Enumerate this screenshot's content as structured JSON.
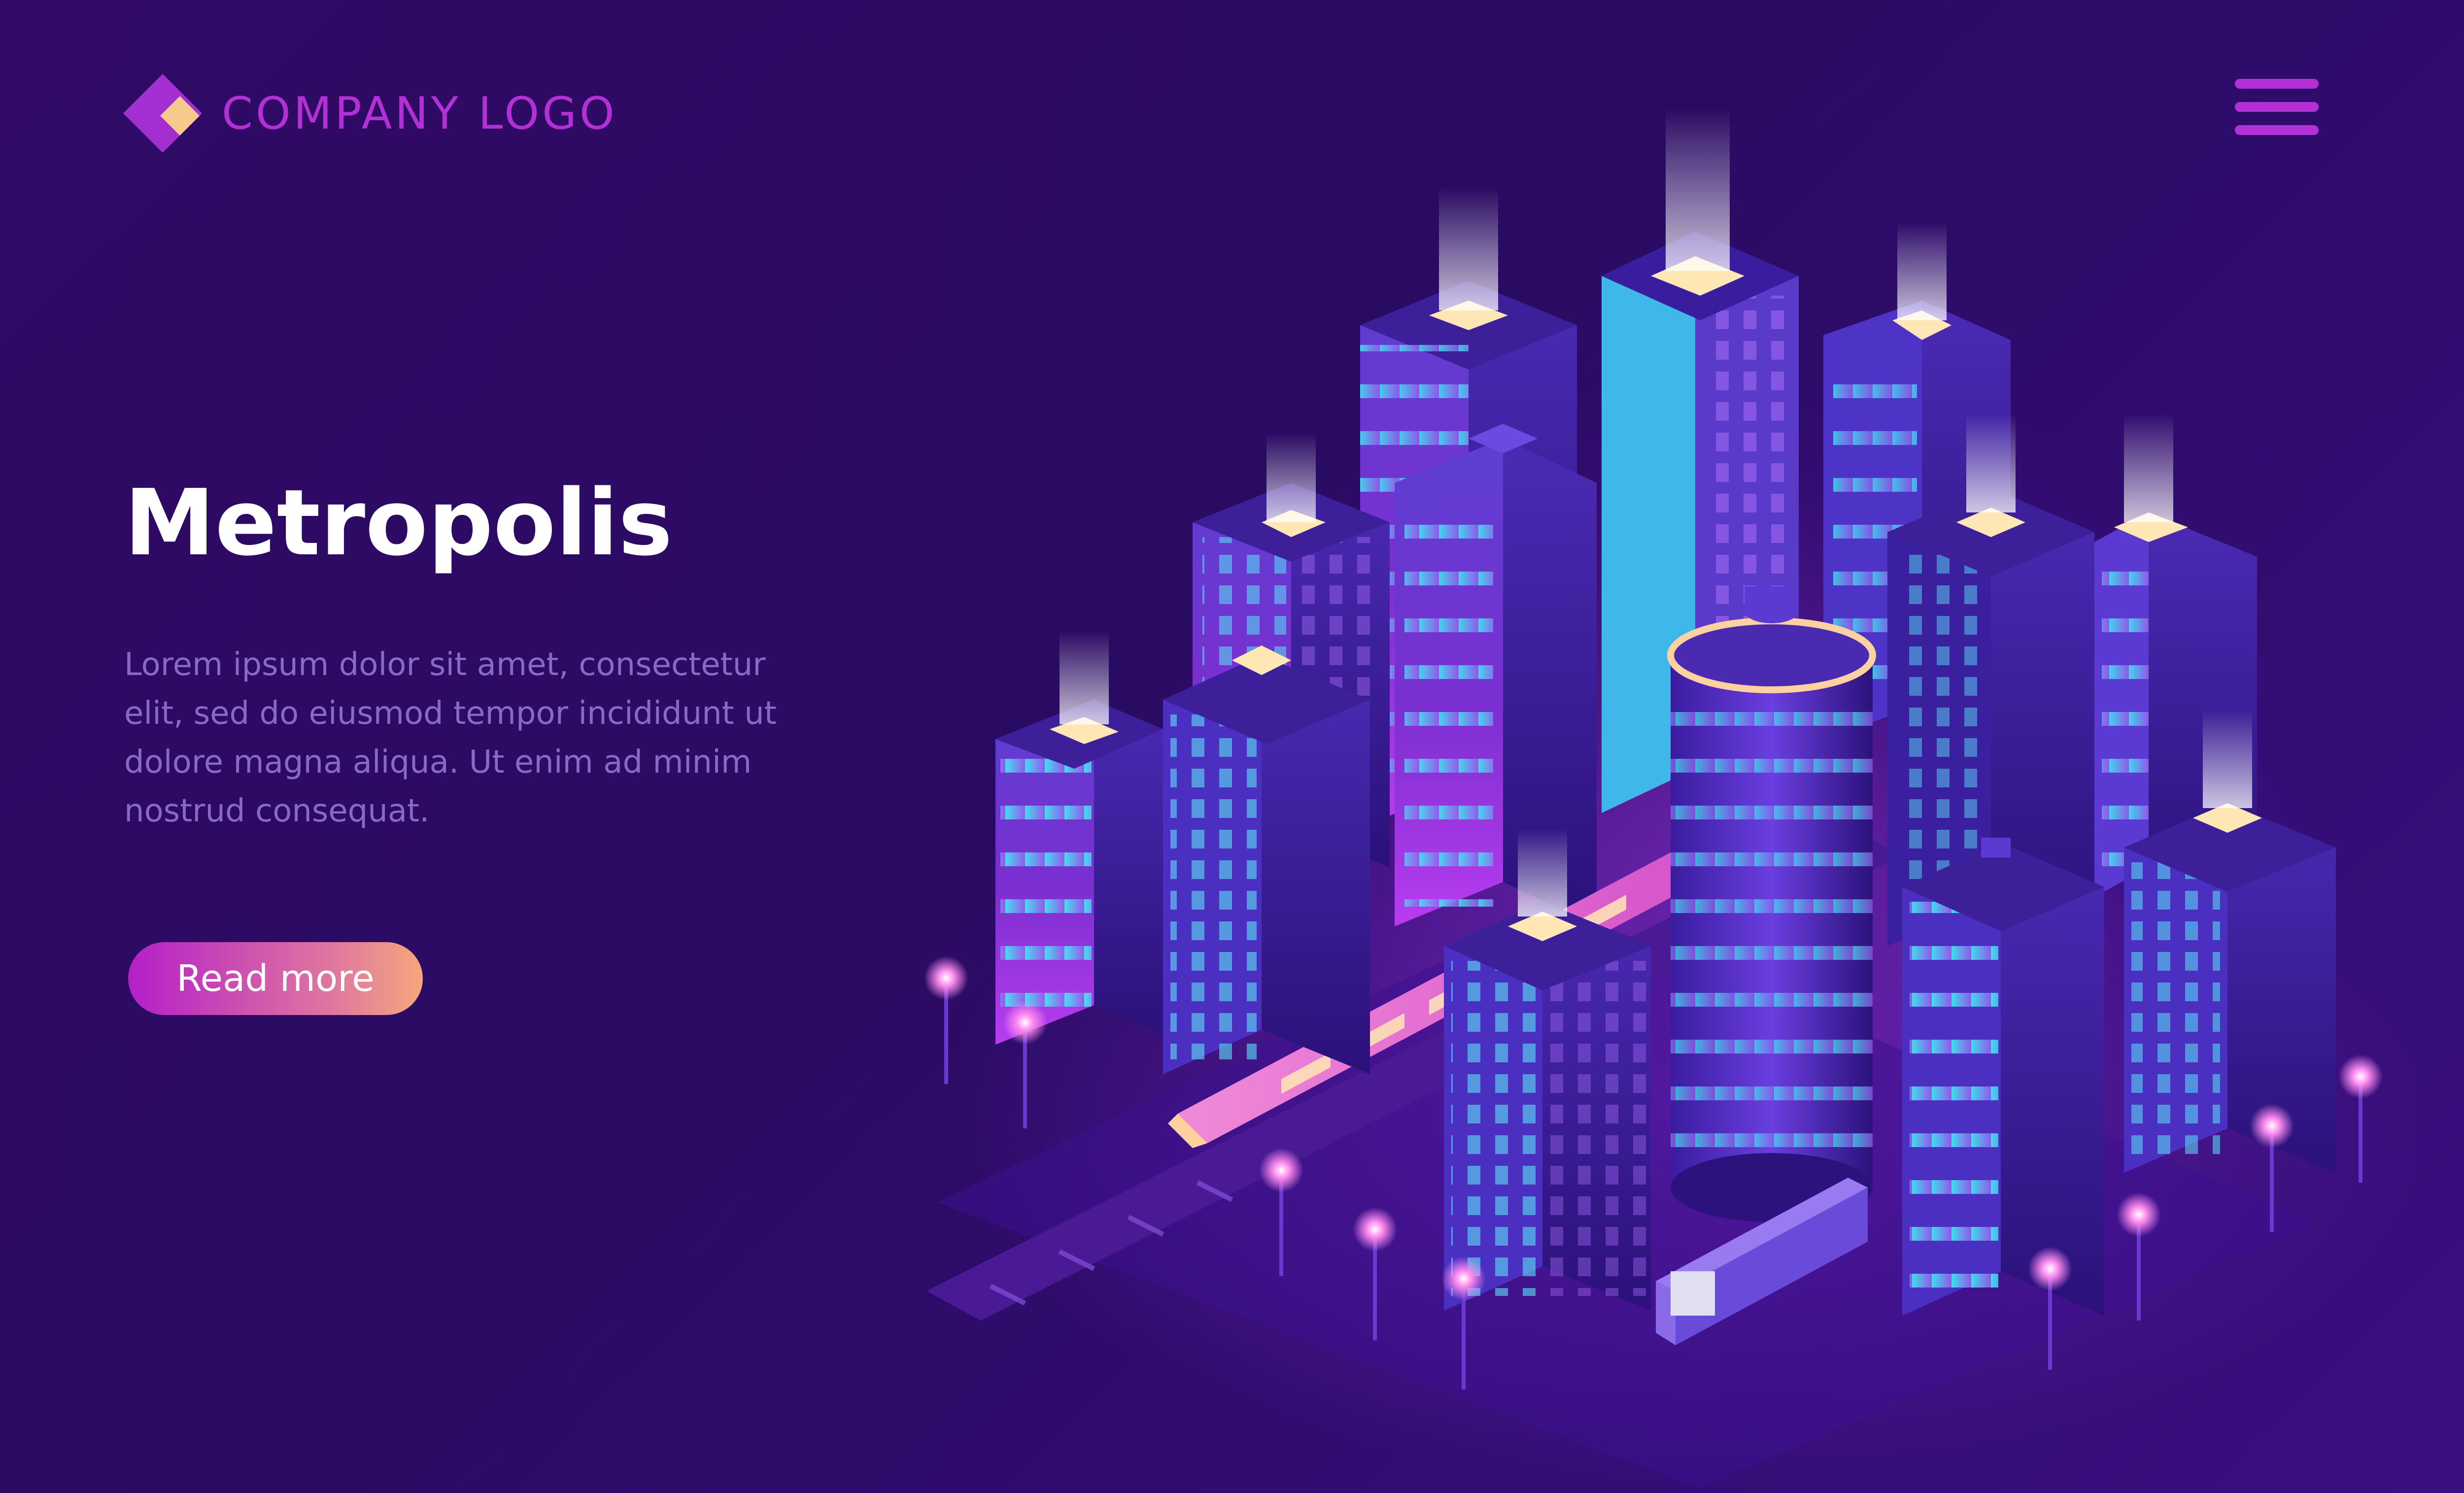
{
  "header": {
    "logo_text": "COMPANY LOGO",
    "logo_icon": "diamond-logo-icon",
    "menu_icon": "hamburger-menu-icon"
  },
  "hero": {
    "title": "Metropolis",
    "description": "Lorem ipsum dolor sit amet, consectetur elit, sed do eiusmod tempor incididunt ut dolore magna aliqua. Ut enim ad minim nostrud consequat.",
    "button_label": "Read more"
  },
  "illustration": {
    "subject": "isometric-neon-city-icon"
  },
  "colors": {
    "background": "#2a0b63",
    "accent": "#b32fd6",
    "title": "#ffffff",
    "body_text": "#8868c8",
    "button_gradient_start": "#b41fc8",
    "button_gradient_end": "#f4a77c",
    "neon_cyan": "#3fe9f2",
    "window_glow": "#ffe7b5"
  }
}
